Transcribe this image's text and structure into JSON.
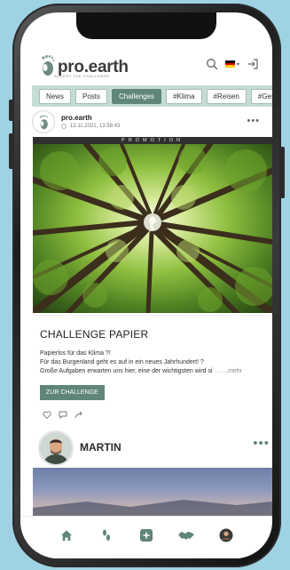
{
  "header": {
    "logo_text": "pro.earth",
    "logo_tagline": "ACCEPT THE CHALLENGE",
    "language": "▾"
  },
  "tabs": [
    {
      "label": "News",
      "active": false
    },
    {
      "label": "Posts",
      "active": false
    },
    {
      "label": "Challenges",
      "active": true
    },
    {
      "label": "#Klima",
      "active": false
    },
    {
      "label": "#Reisen",
      "active": false
    },
    {
      "label": "#Ges",
      "active": false
    }
  ],
  "post": {
    "author": "pro.earth",
    "timestamp": "13.11.2021, 13:58:43",
    "promo_label": "PROMOTION",
    "more": "•••",
    "title": "CHALLENGE PAPIER",
    "lines": [
      "Papierlos für das Klima ?!",
      "Für das Burgenland geht es auf in ein neues Jahrhundert! ?",
      "Große Aufgaben erwarten uns hier, eine der wichtigsten wird si"
    ],
    "more_link": "...mehr",
    "cta_label": "ZUR CHALLENGE"
  },
  "post2": {
    "author": "MARTIN",
    "more": "•••"
  },
  "bottom_nav": [
    "home-icon",
    "footprints-icon",
    "add-icon",
    "handshake-icon",
    "profile-icon"
  ],
  "colors": {
    "accent": "#5f8677",
    "tab_bar": "#c7dbd5",
    "background": "#9fd3e4"
  }
}
